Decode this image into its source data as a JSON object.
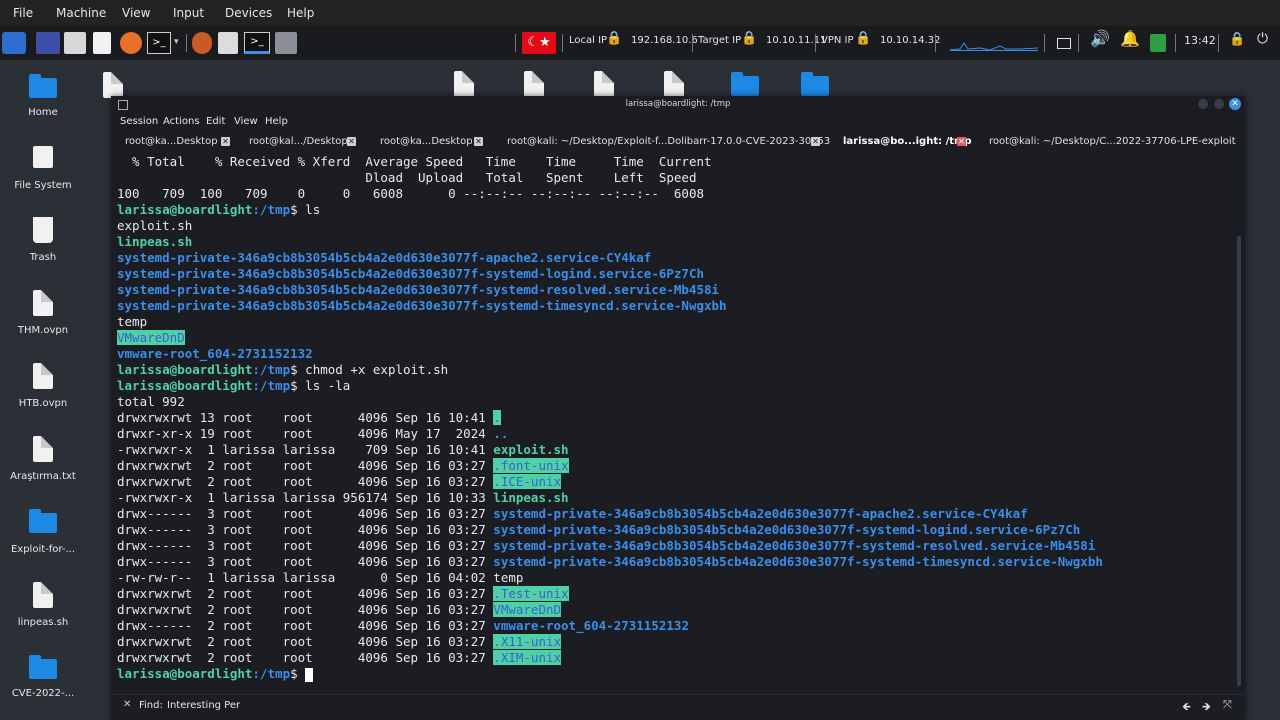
{
  "vm_menu": [
    "File",
    "Machine",
    "View",
    "Input",
    "Devices",
    "Help"
  ],
  "panel": {
    "local_ip_label": "Local IP",
    "local_ip": "192.168.10.6",
    "target_ip_label": "Target IP",
    "target_ip": "10.10.11.11",
    "vpn_ip_label": "VPN IP",
    "vpn_ip": "10.10.14.32",
    "clock": "13:42"
  },
  "desktop_icons": [
    "Home",
    "File System",
    "Trash",
    "THM.ovpn",
    "HTB.ovpn",
    "Araştırma.txt",
    "Exploit-for-...",
    "linpeas.sh",
    "CVE-2022-..."
  ],
  "terminal": {
    "title": "larissa@boardlight: /tmp",
    "menu": [
      "Session",
      "Actions",
      "Edit",
      "View",
      "Help"
    ],
    "tabs": [
      "root@ka...Desktop",
      "root@kal.../Desktop",
      "root@ka...Desktop",
      "root@kali: ~/Desktop/Exploit-f...Dolibarr-17.0.0-CVE-2023-30253",
      "larissa@bo...ight: /tmp",
      "root@kali: ~/Desktop/C...2022-37706-LPE-exploit"
    ],
    "prompt_user": "larissa@boardlight",
    "prompt_path": ":/tmp",
    "prompt_sym": "$ ",
    "curl_hdr1": "  % Total    % Received % Xferd  Average Speed   Time    Time     Time  Current",
    "curl_hdr2": "                                 Dload  Upload   Total   Spent    Left  Speed",
    "curl_row": "100   709  100   709    0     0   6008      0 --:--:-- --:--:-- --:--:--  6008",
    "cmd1": "ls",
    "ls_exploit": "exploit.sh",
    "ls_linpeas": "linpeas.sh",
    "ls_apache": "systemd-private-346a9cb8b3054b5cb4a2e0d630e3077f-apache2.service-CY4kaf",
    "ls_logind": "systemd-private-346a9cb8b3054b5cb4a2e0d630e3077f-systemd-logind.service-6Pz7Ch",
    "ls_resolved": "systemd-private-346a9cb8b3054b5cb4a2e0d630e3077f-systemd-resolved.service-Mb458i",
    "ls_timesync": "systemd-private-346a9cb8b3054b5cb4a2e0d630e3077f-systemd-timesyncd.service-Nwgxbh",
    "ls_temp": "temp",
    "ls_vmdnd": "VMwareDnD",
    "ls_vmroot": "vmware-root_604-2731152132",
    "cmd2": "chmod +x exploit.sh",
    "cmd3": "ls -la",
    "total": "total 992",
    "la_rows": [
      {
        "meta": "drwxrwxrwt 13 root    root      4096 Sep 16 10:41 ",
        "name": "."
      },
      {
        "meta": "drwxr-xr-x 19 root    root      4096 May 17  2024 ",
        "name": ".."
      },
      {
        "meta": "-rwxrwxr-x  1 larissa larissa    709 Sep 16 10:41 ",
        "name": "exploit.sh"
      },
      {
        "meta": "drwxrwxrwt  2 root    root      4096 Sep 16 03:27 ",
        "name": ".font-unix"
      },
      {
        "meta": "drwxrwxrwt  2 root    root      4096 Sep 16 03:27 ",
        "name": ".ICE-unix"
      },
      {
        "meta": "-rwxrwxr-x  1 larissa larissa 956174 Sep 16 10:33 ",
        "name": "linpeas.sh"
      },
      {
        "meta": "drwx------  3 root    root      4096 Sep 16 03:27 ",
        "name": "systemd-private-346a9cb8b3054b5cb4a2e0d630e3077f-apache2.service-CY4kaf"
      },
      {
        "meta": "drwx------  3 root    root      4096 Sep 16 03:27 ",
        "name": "systemd-private-346a9cb8b3054b5cb4a2e0d630e3077f-systemd-logind.service-6Pz7Ch"
      },
      {
        "meta": "drwx------  3 root    root      4096 Sep 16 03:27 ",
        "name": "systemd-private-346a9cb8b3054b5cb4a2e0d630e3077f-systemd-resolved.service-Mb458i"
      },
      {
        "meta": "drwx------  3 root    root      4096 Sep 16 03:27 ",
        "name": "systemd-private-346a9cb8b3054b5cb4a2e0d630e3077f-systemd-timesyncd.service-Nwgxbh"
      },
      {
        "meta": "-rw-rw-r--  1 larissa larissa      0 Sep 16 04:02 ",
        "name": "temp"
      },
      {
        "meta": "drwxrwxrwt  2 root    root      4096 Sep 16 03:27 ",
        "name": ".Test-unix"
      },
      {
        "meta": "drwxrwxrwt  2 root    root      4096 Sep 16 03:27 ",
        "name": "VMwareDnD"
      },
      {
        "meta": "drwx------  2 root    root      4096 Sep 16 03:27 ",
        "name": "vmware-root_604-2731152132"
      },
      {
        "meta": "drwxrwxrwt  2 root    root      4096 Sep 16 03:27 ",
        "name": ".X11-unix"
      },
      {
        "meta": "drwxrwxrwt  2 root    root      4096 Sep 16 03:27 ",
        "name": ".XIM-unix"
      }
    ],
    "find_label": "Find:",
    "find_value": "Interesting Per"
  },
  "colors": {
    "prompt": "#4fd1a5",
    "dir": "#3b8eea",
    "highlight": "#4fd1a5",
    "terminal_bg": "#1b1d22"
  }
}
